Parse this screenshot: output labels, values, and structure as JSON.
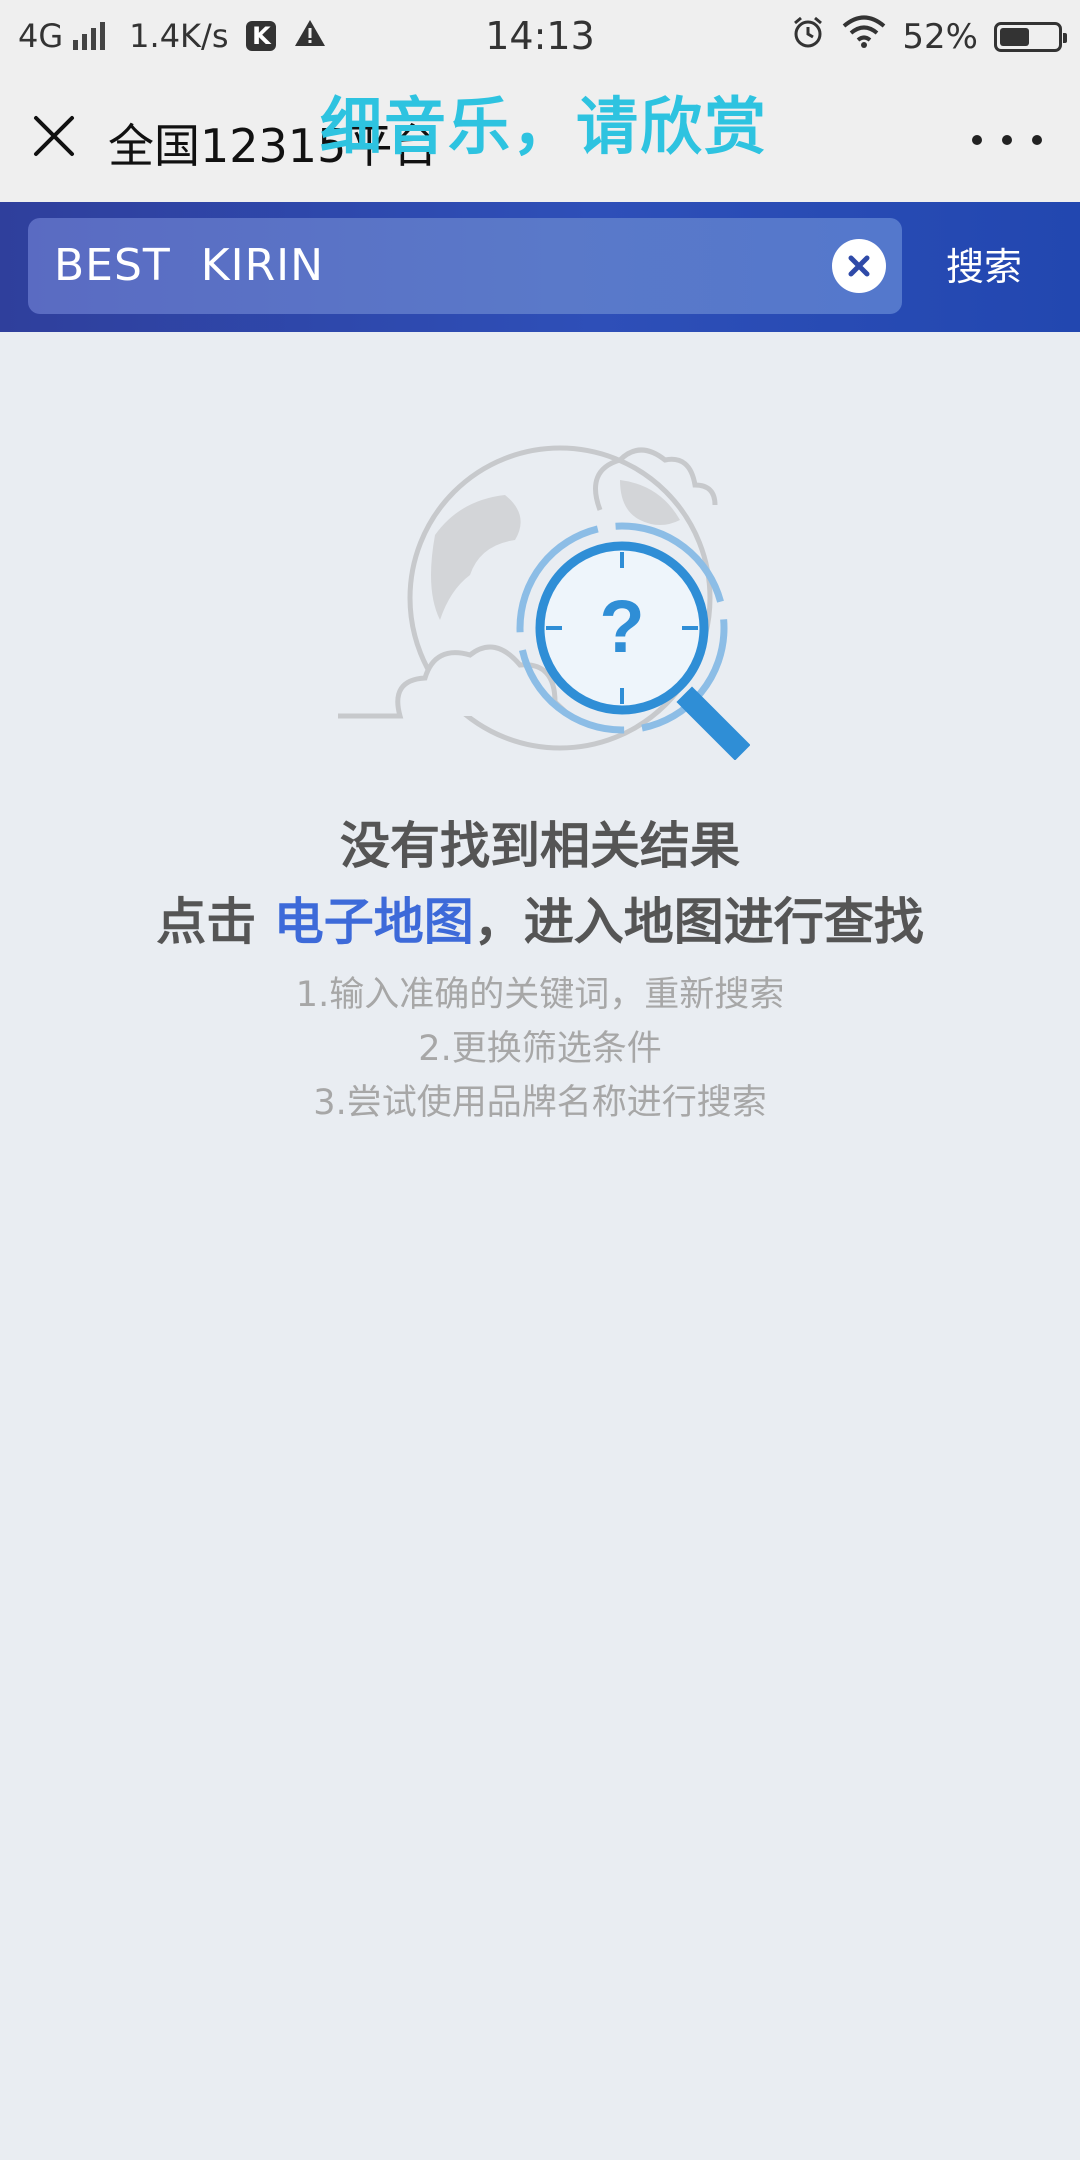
{
  "status_bar": {
    "network": "4G",
    "speed": "1.4K/s",
    "k_badge": "K",
    "time": "14:13",
    "battery": "52%",
    "battery_level": 0.52
  },
  "title_bar": {
    "title": "全国12315平台",
    "overlay_caption": "细音乐，请欣赏"
  },
  "search": {
    "value": "BEST  KIRIN",
    "button_label": "搜索"
  },
  "empty_state": {
    "title": "没有找到相关结果",
    "cta_prefix": "点击 ",
    "cta_link": "电子地图",
    "cta_suffix": "，进入地图进行查找",
    "tips": [
      "1.输入准确的关键词，重新搜索",
      "2.更换筛选条件",
      "3.尝试使用品牌名称进行搜索"
    ]
  },
  "colors": {
    "header_gradient_start": "#2f3f9c",
    "header_gradient_end": "#2247b0",
    "link": "#3d6ad9",
    "caption": "#2ec3e0",
    "page_bg": "#e9edf2"
  },
  "icons": [
    "signal-icon",
    "k-app-icon",
    "warning-icon",
    "alarm-icon",
    "wifi-icon",
    "battery-icon",
    "close-icon",
    "more-icon",
    "clear-icon",
    "not-found-illustration"
  ]
}
